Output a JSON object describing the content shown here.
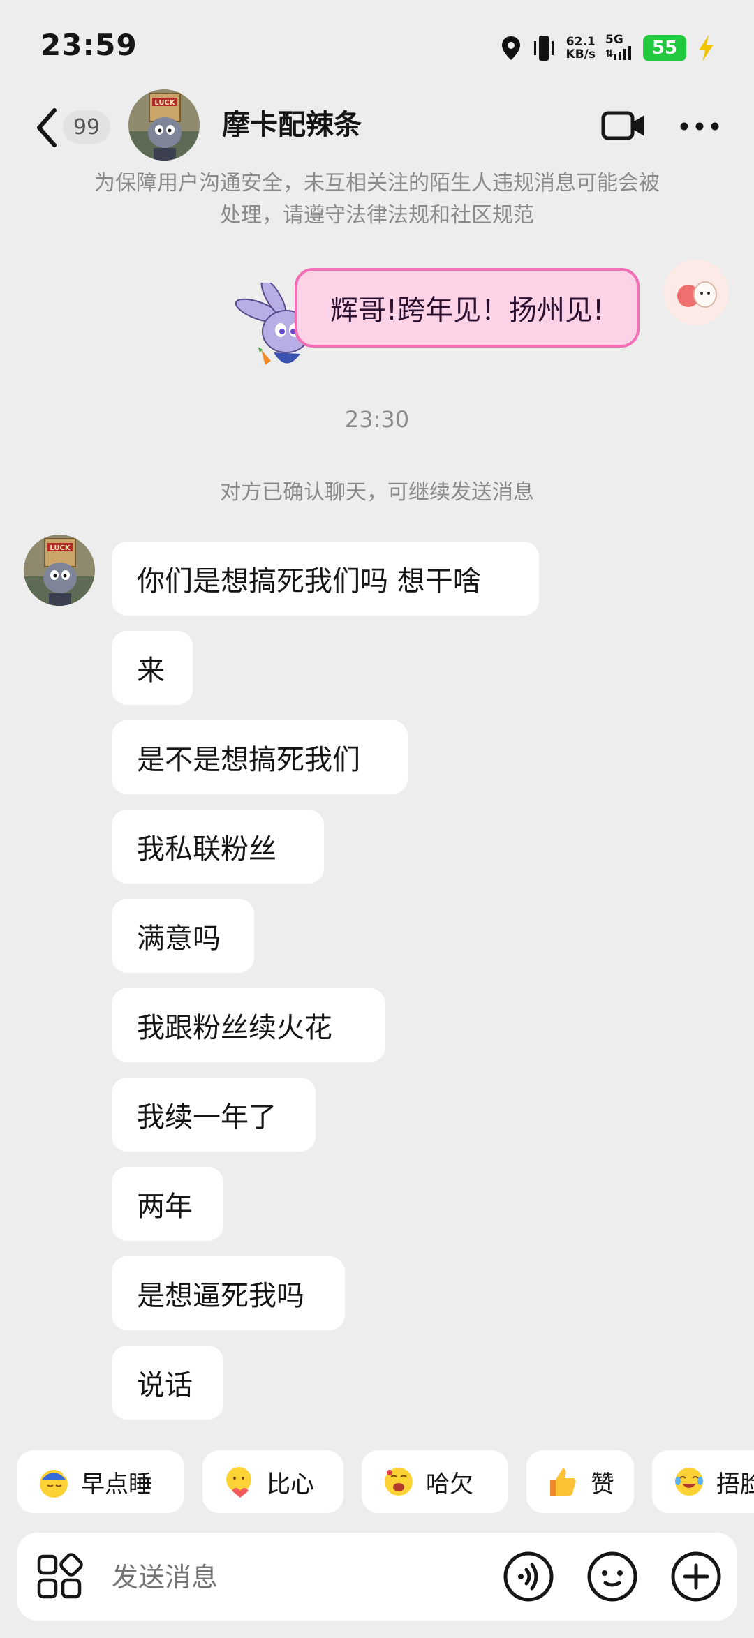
{
  "status_bar": {
    "time": "23:59",
    "speed_value": "62.1",
    "speed_unit": "KB/s",
    "network": "5G",
    "battery": "55"
  },
  "header": {
    "unread_count": "99",
    "contact_name": "摩卡配辣条",
    "icons": [
      "back-icon",
      "video-call-icon",
      "more-icon"
    ]
  },
  "notice": "为保障用户沟通安全，未互相关注的陌生人违规消息可能会被处理，请遵守法律法规和社区规范",
  "my_message": "辉哥!跨年见！扬州见!",
  "timestamp": "23:30",
  "system_message": "对方已确认聊天，可继续发送消息",
  "other_messages": [
    "你们是想搞死我们吗 想干啥",
    "来",
    "是不是想搞死我们",
    "我私联粉丝",
    "满意吗",
    "我跟粉丝续火花",
    "我续一年了",
    "两年",
    "是想逼死我吗",
    "说话"
  ],
  "quick_replies": [
    {
      "label": "早点睡",
      "icon": "sleep-emoji-icon"
    },
    {
      "label": "比心",
      "icon": "heart-hands-emoji-icon"
    },
    {
      "label": "哈欠",
      "icon": "yawn-emoji-icon"
    },
    {
      "label": "赞",
      "icon": "thumbs-up-emoji-icon"
    },
    {
      "label": "捂脸",
      "icon": "facepalm-emoji-icon"
    }
  ],
  "input": {
    "placeholder": "发送消息"
  },
  "colors": {
    "background": "#ededed",
    "my_bubble_fill": "#fbd2e6",
    "my_bubble_border": "#f06fb5",
    "battery": "#22c93f"
  }
}
